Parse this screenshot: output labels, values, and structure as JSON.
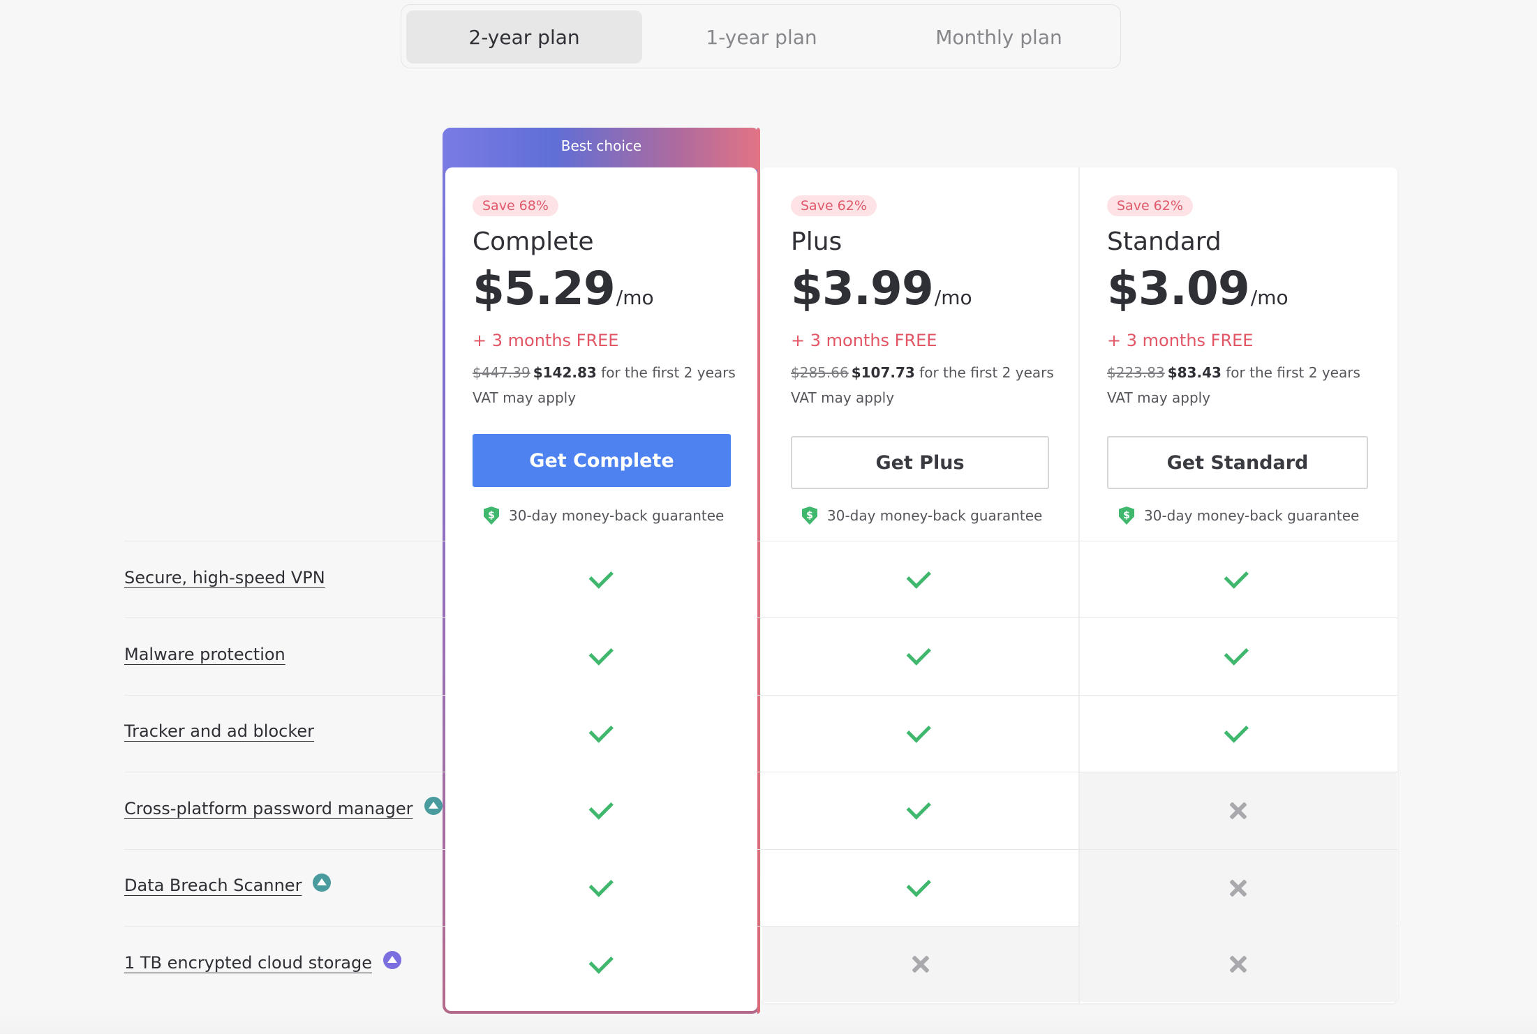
{
  "tabs": [
    {
      "label": "2-year plan",
      "active": true
    },
    {
      "label": "1-year plan",
      "active": false
    },
    {
      "label": "Monthly plan",
      "active": false
    }
  ],
  "highlight": {
    "label": "Best choice"
  },
  "plans": [
    {
      "save": "Save 68%",
      "name": "Complete",
      "price": "$5.29",
      "per": "/mo",
      "bonus": "+ 3 months FREE",
      "old_price": "$447.39",
      "new_price": "$142.83",
      "period": "for the first 2 years",
      "vat": "VAT may apply",
      "cta": "Get Complete",
      "guarantee": "30-day money-back guarantee"
    },
    {
      "save": "Save 62%",
      "name": "Plus",
      "price": "$3.99",
      "per": "/mo",
      "bonus": "+ 3 months FREE",
      "old_price": "$285.66",
      "new_price": "$107.73",
      "period": "for the first 2 years",
      "vat": "VAT may apply",
      "cta": "Get Plus",
      "guarantee": "30-day money-back guarantee"
    },
    {
      "save": "Save 62%",
      "name": "Standard",
      "price": "$3.09",
      "per": "/mo",
      "bonus": "+ 3 months FREE",
      "old_price": "$223.83",
      "new_price": "$83.43",
      "period": "for the first 2 years",
      "vat": "VAT may apply",
      "cta": "Get Standard",
      "guarantee": "30-day money-back guarantee"
    }
  ],
  "features": [
    {
      "label": "Secure, high-speed VPN",
      "icon": null,
      "included": [
        true,
        true,
        true
      ]
    },
    {
      "label": "Malware protection",
      "icon": null,
      "included": [
        true,
        true,
        true
      ]
    },
    {
      "label": "Tracker and ad blocker",
      "icon": null,
      "included": [
        true,
        true,
        true
      ]
    },
    {
      "label": "Cross-platform password manager",
      "icon": "password-manager-icon",
      "icon_color": "#4a9b9e",
      "included": [
        true,
        true,
        false
      ]
    },
    {
      "label": "Data Breach Scanner",
      "icon": "breach-scanner-icon",
      "icon_color": "#4a9b9e",
      "included": [
        true,
        true,
        false
      ]
    },
    {
      "label": "1 TB encrypted cloud storage",
      "icon": "cloud-storage-icon",
      "icon_color": "#7b6fe0",
      "included": [
        true,
        false,
        false
      ]
    }
  ],
  "colors": {
    "accent": "#4d82f0",
    "check": "#3fb76c",
    "bonus": "#e25565",
    "badge_bg": "#fde3e6"
  }
}
